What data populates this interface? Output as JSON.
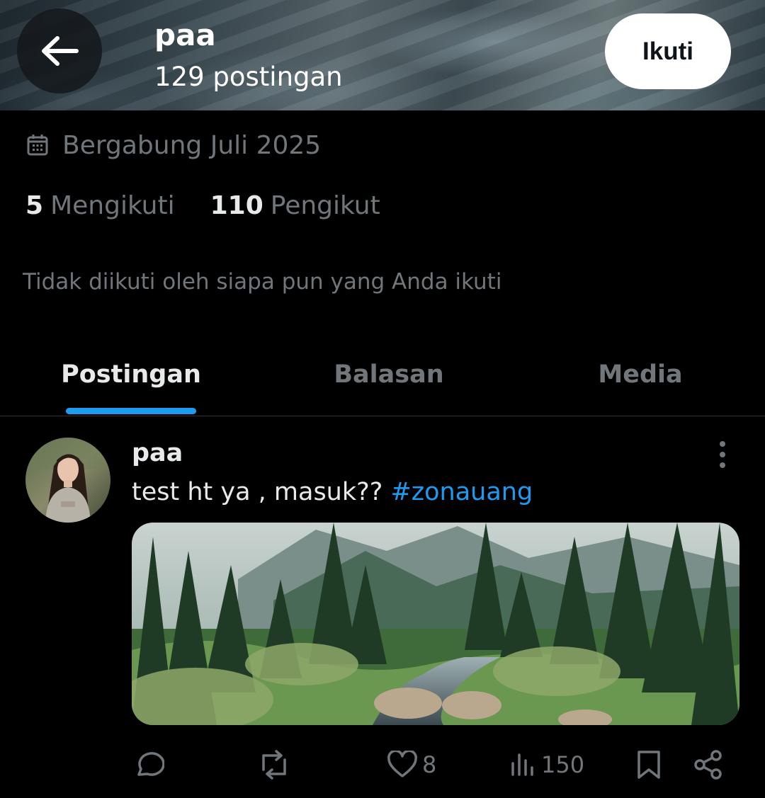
{
  "header": {
    "name": "paa",
    "post_count": "129 postingan",
    "follow_label": "Ikuti"
  },
  "profile": {
    "joined": "Bergabung Juli 2025",
    "following_count": "5",
    "following_label": "Mengikuti",
    "followers_count": "110",
    "followers_label": "Pengikut",
    "followed_by": "Tidak diikuti oleh siapa pun yang Anda ikuti"
  },
  "tabs": [
    {
      "label": "Postingan",
      "active": true
    },
    {
      "label": "Balasan",
      "active": false
    },
    {
      "label": "Media",
      "active": false
    }
  ],
  "post": {
    "author": "paa",
    "text": "test ht ya , masuk??",
    "hashtag": "#zonauang",
    "likes": "8",
    "views": "150"
  },
  "colors": {
    "accent": "#1d9bf0",
    "muted": "#71767b",
    "text": "#e7e9ea",
    "background": "#000000"
  },
  "icons": {
    "back": "arrow-left-icon",
    "calendar": "calendar-icon",
    "more": "more-vertical-icon",
    "reply": "reply-icon",
    "repost": "repost-icon",
    "like": "heart-icon",
    "views": "views-icon",
    "bookmark": "bookmark-icon",
    "share": "share-icon"
  }
}
